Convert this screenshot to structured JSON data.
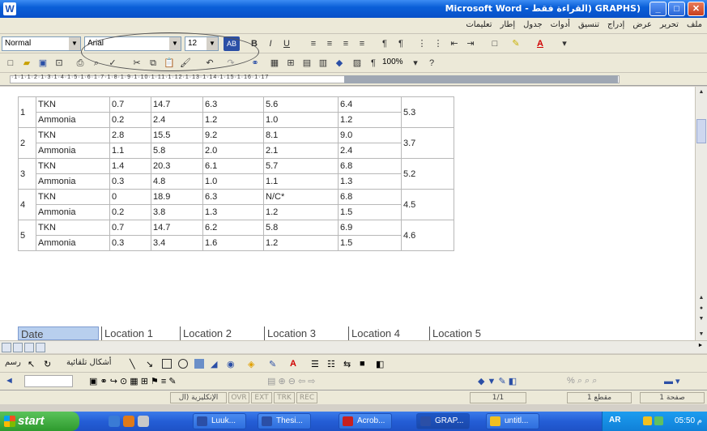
{
  "window": {
    "title": "Microsoft Word - القراءة فقط) GRAPHS)"
  },
  "menubar": {
    "items": [
      "ملف",
      "تحرير",
      "عرض",
      "إدراج",
      "تنسيق",
      "أدوات",
      "جدول",
      "إطار",
      "تعليمات"
    ]
  },
  "toolbar_format": {
    "style_value": "Normal",
    "font_value": "Arial",
    "size_value": "12",
    "bold_label": "B",
    "italic_label": "I",
    "underline_label": "U"
  },
  "toolbar_standard": {
    "zoom_value": "100%"
  },
  "table": {
    "groups": [
      {
        "index": "1",
        "last": "5.3",
        "rows": [
          {
            "name": "TKN",
            "v": [
              "0.7",
              "14.7",
              "6.3",
              "5.6",
              "6.4"
            ]
          },
          {
            "name": "Ammonia",
            "v": [
              "0.2",
              "2.4",
              "1.2",
              "1.0",
              "1.2"
            ]
          }
        ]
      },
      {
        "index": "2",
        "last": "3.7",
        "rows": [
          {
            "name": "TKN",
            "v": [
              "2.8",
              "15.5",
              "9.2",
              "8.1",
              "9.0"
            ]
          },
          {
            "name": "Ammonia",
            "v": [
              "1.1",
              "5.8",
              "2.0",
              "2.1",
              "2.4"
            ]
          }
        ]
      },
      {
        "index": "3",
        "last": "5.2",
        "rows": [
          {
            "name": "TKN",
            "v": [
              "1.4",
              "20.3",
              "6.1",
              "5.7",
              "6.8"
            ]
          },
          {
            "name": "Ammonia",
            "v": [
              "0.3",
              "4.8",
              "1.0",
              "1.1",
              "1.3"
            ]
          }
        ]
      },
      {
        "index": "4",
        "last": "4.5",
        "rows": [
          {
            "name": "TKN",
            "v": [
              "0",
              "18.9",
              "6.3",
              "N/C*",
              "6.8"
            ]
          },
          {
            "name": "Ammonia",
            "v": [
              "0.2",
              "3.8",
              "1.3",
              "1.2",
              "1.5"
            ]
          }
        ]
      },
      {
        "index": "5",
        "last": "4.6",
        "rows": [
          {
            "name": "TKN",
            "v": [
              "0.7",
              "14.7",
              "6.2",
              "5.8",
              "6.9"
            ]
          },
          {
            "name": "Ammonia",
            "v": [
              "0.3",
              "3.4",
              "1.6",
              "1.2",
              "1.5"
            ]
          }
        ]
      }
    ]
  },
  "sheet_tabs": {
    "active_tab": "Date",
    "tabs": [
      "Location 1",
      "Location 2",
      "Location 3",
      "Location 4",
      "Location 5"
    ]
  },
  "drawbar": {
    "draw_label": "رسم",
    "autoshapes_label": "أشكال تلقائية"
  },
  "statusbar": {
    "page": "صفحة 1",
    "section": "مقطع 1",
    "pages": "1/1",
    "rec": "REC",
    "trk": "TRK",
    "ext": "EXT",
    "ovr": "OVR",
    "language": "الإنكليزية (ال"
  },
  "taskbar": {
    "start_label": "start",
    "tasks": [
      "Luuk...",
      "Thesi...",
      "Acrob...",
      "GRAP...",
      "untitl..."
    ],
    "lang": "AR",
    "time": "05:50 م"
  }
}
